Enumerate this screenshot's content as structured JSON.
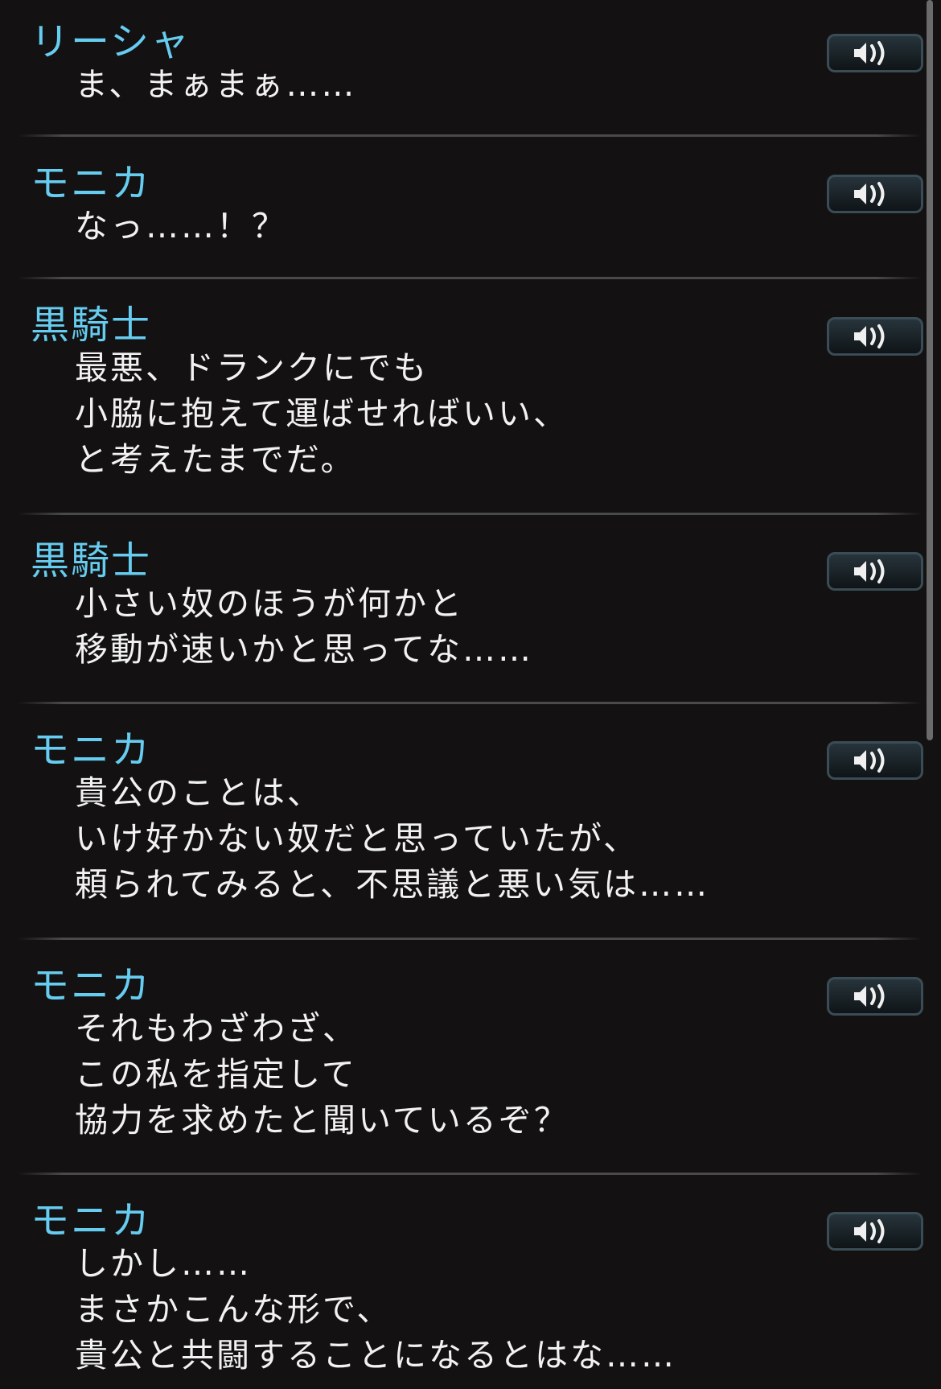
{
  "voice_icon": "speaker-volume-icon",
  "colors": {
    "background": "#131111",
    "speaker_name": "#66ccf0",
    "dialogue_text": "#f2f2f2"
  },
  "entries": [
    {
      "speaker": "リーシャ",
      "lines": [
        "ま、まぁまぁ……"
      ]
    },
    {
      "speaker": "モニカ",
      "lines": [
        "なっ……！？"
      ]
    },
    {
      "speaker": "黒騎士",
      "lines": [
        "最悪、ドランクにでも",
        "小脇に抱えて運ばせればいい、",
        "と考えたまでだ。"
      ]
    },
    {
      "speaker": "黒騎士",
      "lines": [
        "小さい奴のほうが何かと",
        "移動が速いかと思ってな……"
      ]
    },
    {
      "speaker": "モニカ",
      "lines": [
        "貴公のことは、",
        "いけ好かない奴だと思っていたが、",
        "頼られてみると、不思議と悪い気は……"
      ]
    },
    {
      "speaker": "モニカ",
      "lines": [
        "それもわざわざ、",
        "この私を指定して",
        "協力を求めたと聞いているぞ？"
      ]
    },
    {
      "speaker": "モニカ",
      "lines": [
        "しかし……",
        "まさかこんな形で、",
        "貴公と共闘することになるとはな……"
      ]
    }
  ]
}
